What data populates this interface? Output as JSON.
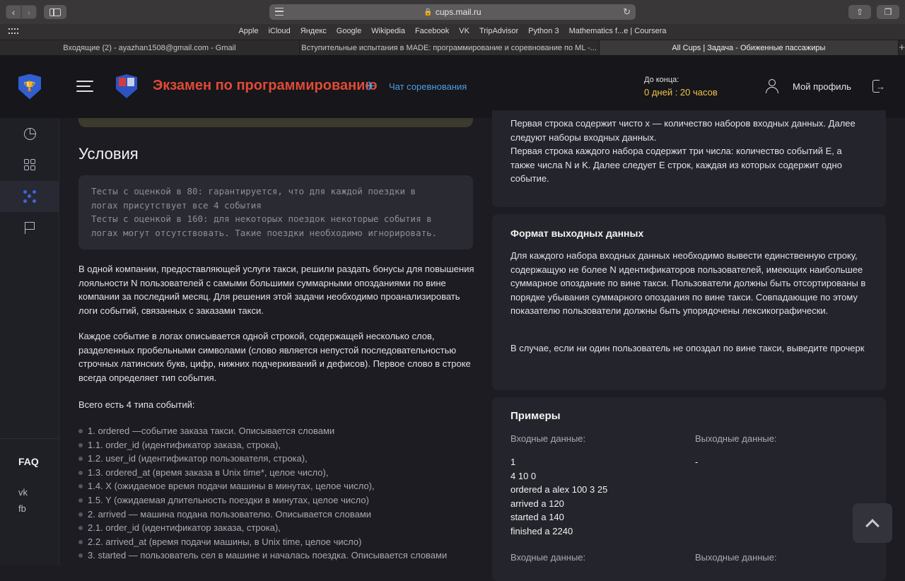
{
  "browser": {
    "url": "cups.mail.ru",
    "favorites": [
      "Apple",
      "iCloud",
      "Яндекс",
      "Google",
      "Wikipedia",
      "Facebook",
      "VK",
      "TripAdvisor",
      "Python 3",
      "Mathematics f...e | Coursera"
    ],
    "tabs": [
      {
        "title": "Входящие (2) - ayazhan1508@gmail.com - Gmail",
        "active": false
      },
      {
        "title": "Вступительные испытания в MADE: программирование и соревнование по ML -...",
        "active": false
      },
      {
        "title": "All Cups | Задача - Обиженные пассажиры",
        "active": true
      }
    ]
  },
  "header": {
    "contest_title": "Экзамен по программированию",
    "chat_link": "Чат соревнования",
    "deadline_label": "До конца:",
    "deadline_value": "0 дней : 20 часов",
    "profile_link": "Мой профиль"
  },
  "rail": {
    "items": [
      "pie-chart-icon",
      "apps-icon",
      "dots-icon",
      "flag-icon"
    ],
    "active_index": 2,
    "faq": "FAQ",
    "social": [
      "vk",
      "fb"
    ]
  },
  "conditions": {
    "title": "Условия",
    "code_lines": [
      "Тесты с оценкой в 80: гарантируется, что для каждой поездки в",
      "логах присутствует все 4 события",
      "Тесты с оценкой в 160: для некоторых поездок некоторые события в",
      "логах могут отсутствовать. Такие поездки необходимо игнорировать."
    ],
    "paragraphs": [
      "В одной компании, предоставляющей услуги такси, решили раздать бонусы для повышения лояльности N пользователей с самыми большими суммарными опозданиями по вине компании за последний месяц. Для решения этой задачи необходимо проанализировать логи событий, связанных с заказами такси.",
      "Каждое событие в логах описывается одной строкой, содержащей несколько слов, разделенных пробельными символами (слово является непустой последовательностью строчных латинских букв, цифр, нижних подчеркиваний и дефисов). Первое слово в строке всегда определяет тип события.",
      "Всего есть 4 типа событий:"
    ],
    "events": [
      "1. ordered —событие заказа такси. Описывается словами",
      "1.1. order_id (идентификатор заказа, строка),",
      "1.2. user_id (идентификатор пользователя, строка),",
      "1.3. ordered_at (время заказа в Unix time*, целое число),",
      "1.4. X (ожидаемое время подачи машины в минутах, целое число),",
      "1.5. Y (ожидаемая длительность поездки в минутах, целое число)",
      "2. arrived — машина подана пользователю. Описывается словами",
      "2.1. order_id (идентификатор заказа, строка),",
      "2.2. arrived_at (время подачи машины, в Unix time, целое число)",
      "3. started — пользователь сел в машине и началась поездка. Описывается словами"
    ]
  },
  "input_format": {
    "lines": [
      "Первая строка содержит чисто x — количество наборов входных данных. Далее следуют наборы входных данных.",
      "Первая строка каждого набора содержит три числа: количество событий E, а также числа N и K. Далее следует E строк, каждая из которых содержит одно событие."
    ]
  },
  "output_format": {
    "title": "Формат выходных данных",
    "paragraphs": [
      "Для каждого набора входных данных необходимо вывести единственную строку, содержащую не более N идентификаторов пользователей, имеющих наибольшее суммарное опоздание по вине такси. Пользователи должны быть отсортированы в порядке убывания суммарного опоздания по вине такси. Совпадающие по этому показателю пользователи должны быть упорядочены лексикографически.",
      "В случае, если ни один пользователь не опоздал по вине такси, выведите прочерк"
    ]
  },
  "examples": {
    "title": "Примеры",
    "input_label": "Входные данные:",
    "output_label": "Выходные данные:",
    "example1_input": "1\n4 10 0\nordered a alex 100 3 25\narrived a 120\nstarted a 140\nfinished a 2240",
    "example1_output": "-",
    "example2_input_label": "Входные данные:",
    "example2_output_label": "Выходные данные:"
  }
}
